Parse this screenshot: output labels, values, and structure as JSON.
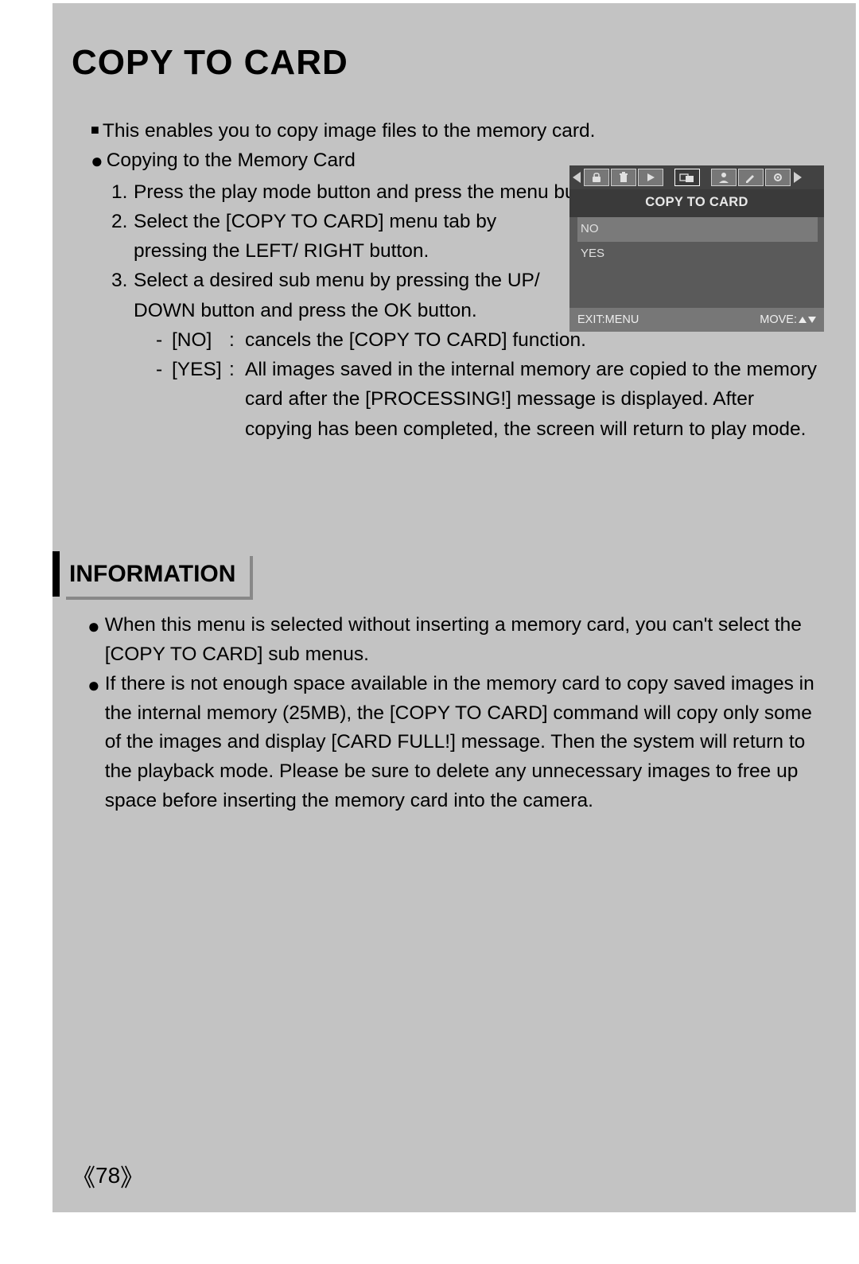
{
  "title": "COPY TO CARD",
  "intro": "This enables you to copy image files to the memory card.",
  "subhead": "Copying to the Memory Card",
  "steps": {
    "s1": "Press the play mode button and press the menu button.",
    "s2": "Select the [COPY TO CARD] menu tab by pressing the LEFT/ RIGHT button.",
    "s3": "Select a desired sub menu by pressing the UP/ DOWN button and press the OK button."
  },
  "options": {
    "no_label": "[NO]",
    "no_text": "cancels the [COPY TO CARD] function.",
    "yes_label": "[YES]",
    "yes_text": "All images saved in the internal memory are copied to the memory card after the [PROCESSING!] message is displayed. After copying has been completed, the screen will return to play mode."
  },
  "camera": {
    "title": "COPY TO CARD",
    "opt_no": "NO",
    "opt_yes": "YES",
    "exit": "EXIT:MENU",
    "move": "MOVE:"
  },
  "info": {
    "head": "INFORMATION",
    "i1": "When this menu is selected without inserting a memory card, you can't select the [COPY TO CARD] sub menus.",
    "i2": "If there is not enough space available in the memory card to copy saved images in the internal memory (25MB), the [COPY TO CARD] command will copy only some of the images and display [CARD FULL!] message. Then the system will return to the playback mode. Please be sure to delete any unnecessary images to free up space before inserting the memory card into the camera."
  },
  "page_number": "78"
}
